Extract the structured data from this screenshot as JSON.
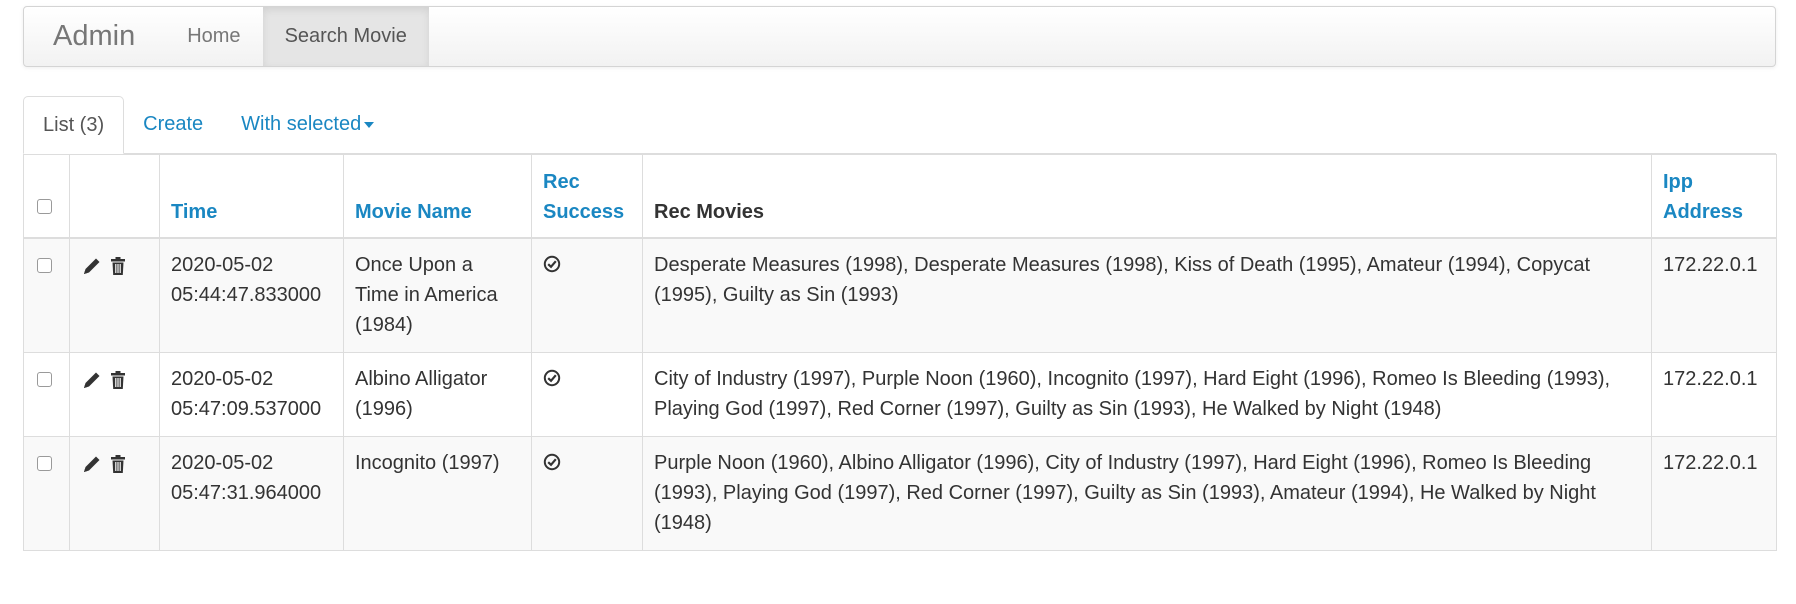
{
  "navbar": {
    "brand": "Admin",
    "items": [
      {
        "label": "Home"
      },
      {
        "label": "Search Movie"
      }
    ]
  },
  "tabs": {
    "list": "List (3)",
    "create": "Create",
    "with_selected": "With selected"
  },
  "table": {
    "headers": {
      "time": "Time",
      "movie_name": "Movie Name",
      "rec_success_1": "Rec",
      "rec_success_2": "Success",
      "rec_movies": "Rec Movies",
      "ip_1": "Ipp",
      "ip_2": "Address"
    },
    "rows": [
      {
        "time_date": "2020-05-02",
        "time_clock": "05:44:47.833000",
        "movie_name": "Once Upon a Time in America (1984)",
        "rec_success": "ok-circle-icon",
        "rec_movies": "Desperate Measures (1998), Desperate Measures (1998), Kiss of Death (1995), Amateur (1994), Copycat (1995), Guilty as Sin (1993)",
        "ip": "172.22.0.1"
      },
      {
        "time_date": "2020-05-02",
        "time_clock": "05:47:09.537000",
        "movie_name": "Albino Alligator (1996)",
        "rec_success": "ok-circle-icon",
        "rec_movies": "City of Industry (1997), Purple Noon (1960), Incognito (1997), Hard Eight (1996), Romeo Is Bleeding (1993), Playing God (1997), Red Corner (1997), Guilty as Sin (1993), He Walked by Night (1948)",
        "ip": "172.22.0.1"
      },
      {
        "time_date": "2020-05-02",
        "time_clock": "05:47:31.964000",
        "movie_name": "Incognito (1997)",
        "rec_success": "ok-circle-icon",
        "rec_movies": "Purple Noon (1960), Albino Alligator (1996), City of Industry (1997), Hard Eight (1996), Romeo Is Bleeding (1993), Playing God (1997), Red Corner (1997), Guilty as Sin (1993), Amateur (1994), He Walked by Night (1948)",
        "ip": "172.22.0.1"
      }
    ]
  },
  "icons": {
    "edit": "pencil-icon",
    "delete": "trash-icon"
  },
  "colors": {
    "link": "#1a87c2",
    "stripe": "#f9f9f9",
    "border": "#dddddd"
  }
}
